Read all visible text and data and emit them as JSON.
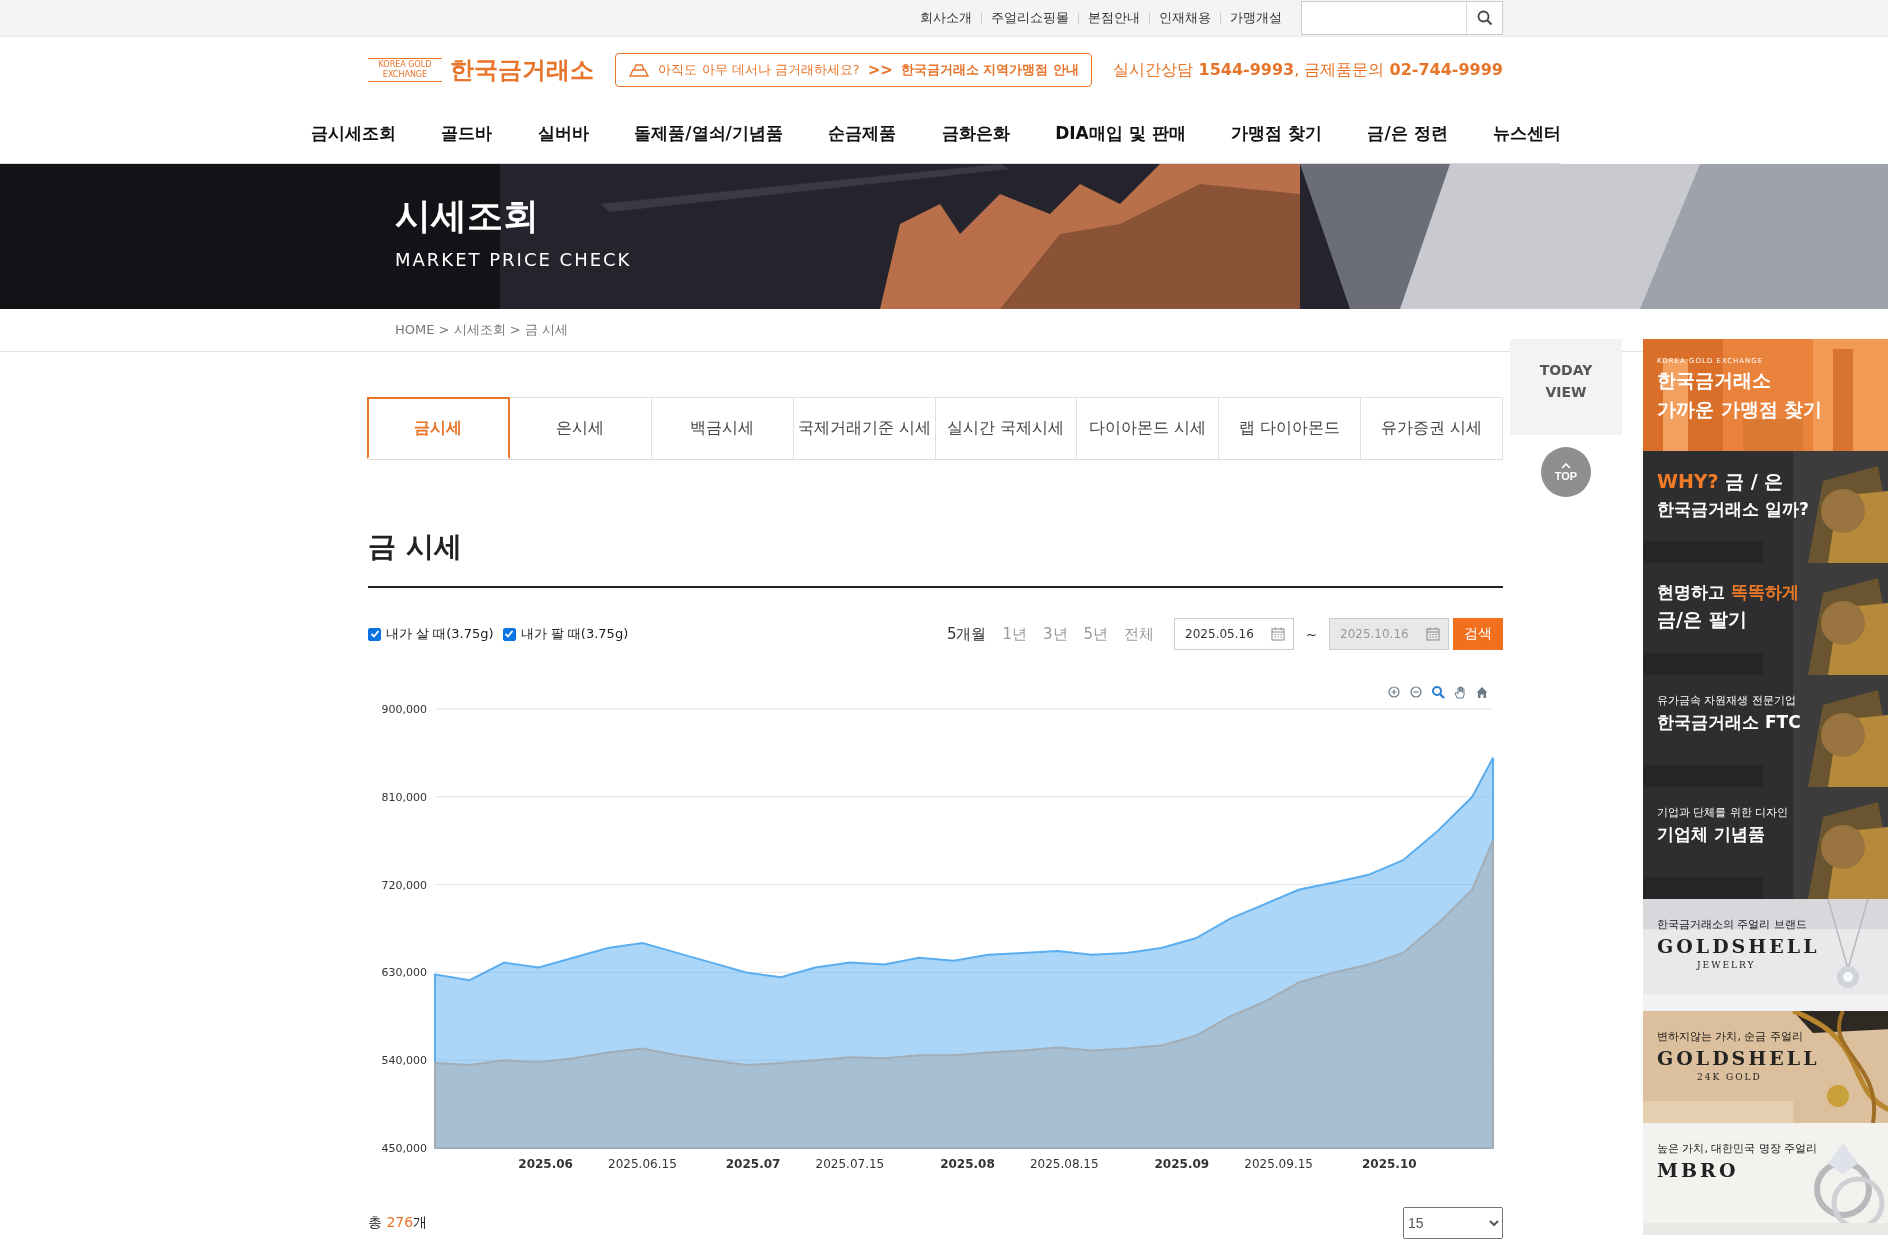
{
  "top_links": [
    {
      "label": "회사소개"
    },
    {
      "label": "주얼리쇼핑몰"
    },
    {
      "label": "본점안내"
    },
    {
      "label": "인재채용"
    },
    {
      "label": "가맹개설"
    }
  ],
  "header": {
    "logo_mark": "KOREA GOLD EXCHANGE",
    "logo_text": "한국금거래소",
    "notice_question": "아직도 아무 데서나 금거래하세요?",
    "notice_arrow": ">>",
    "notice_link": "한국금거래소 지역가맹점 안내",
    "contact": "실시간상담 **1544-9993**, 금제품문의 **02-744-9999**"
  },
  "nav": [
    "금시세조회",
    "골드바",
    "실버바",
    "돌제품/열쇠/기념품",
    "순금제품",
    "금화은화",
    "DIA매입 및 판매",
    "가맹점 찾기",
    "금/은 정련",
    "뉴스센터"
  ],
  "hero": {
    "title": "시세조회",
    "subtitle": "MARKET PRICE CHECK"
  },
  "breadcrumb": "HOME > 시세조회 > 금 시세",
  "tabs": [
    {
      "label": "금시세",
      "selected": true
    },
    {
      "label": "은시세",
      "selected": false
    },
    {
      "label": "백금시세",
      "selected": false
    },
    {
      "label": "국제거래기준 시세",
      "selected": false
    },
    {
      "label": "실시간 국제시세",
      "selected": false
    },
    {
      "label": "다이아몬드 시세",
      "selected": false
    },
    {
      "label": "랩 다이아몬드",
      "selected": false
    },
    {
      "label": "유가증권 시세",
      "selected": false
    }
  ],
  "section_title": "금 시세",
  "filters": [
    {
      "checked": true
    },
    {
      "checked": true
    }
  ],
  "periods": [
    {
      "label": "5개월",
      "selected": true
    },
    {
      "label": "1년",
      "selected": false
    },
    {
      "label": "3년",
      "selected": false
    },
    {
      "label": "5년",
      "selected": false
    },
    {
      "label": "전체",
      "selected": false
    }
  ],
  "date_from": {
    "value": "2025.05.16",
    "disabled": false
  },
  "date_sep": "~",
  "date_to": {
    "value": "2025.10.16",
    "disabled": true
  },
  "search_button": "검색",
  "chart_data": {
    "type": "area",
    "x": [
      "2025-05-16",
      "2025-05-21",
      "2025-05-26",
      "2025-05-31",
      "2025-06-05",
      "2025-06-10",
      "2025-06-15",
      "2025-06-20",
      "2025-06-25",
      "2025-06-30",
      "2025-07-05",
      "2025-07-10",
      "2025-07-15",
      "2025-07-20",
      "2025-07-25",
      "2025-07-30",
      "2025-08-04",
      "2025-08-09",
      "2025-08-14",
      "2025-08-19",
      "2025-08-24",
      "2025-08-29",
      "2025-09-03",
      "2025-09-08",
      "2025-09-13",
      "2025-09-18",
      "2025-09-23",
      "2025-09-28",
      "2025-10-03",
      "2025-10-08",
      "2025-10-13",
      "2025-10-16"
    ],
    "series": [
      {
        "name": "내가 살 때(3.75g)",
        "color": "#5aaef0",
        "values": [
          628000,
          622000,
          640000,
          635000,
          645000,
          655000,
          660000,
          650000,
          640000,
          630000,
          625000,
          635000,
          640000,
          638000,
          645000,
          642000,
          648000,
          650000,
          652000,
          648000,
          650000,
          655000,
          665000,
          685000,
          700000,
          715000,
          722000,
          730000,
          745000,
          775000,
          810000,
          850000
        ]
      },
      {
        "name": "내가 팔 때(3.75g)",
        "color": "#a3adb6",
        "values": [
          537000,
          535000,
          540000,
          538000,
          542000,
          548000,
          552000,
          545000,
          540000,
          535000,
          537000,
          540000,
          543000,
          542000,
          545000,
          545000,
          548000,
          550000,
          553000,
          550000,
          552000,
          555000,
          565000,
          585000,
          600000,
          620000,
          630000,
          638000,
          650000,
          680000,
          715000,
          765000
        ]
      }
    ],
    "xlim": [
      "2025-05-16",
      "2025-10-16"
    ],
    "ylim": [
      450000,
      900000
    ],
    "grid": true,
    "stacked": false,
    "xticks": [
      {
        "value": "2025-06-01",
        "label": "2025.06"
      },
      {
        "value": "2025-06-15",
        "label": "2025.06.15"
      },
      {
        "value": "2025-07-01",
        "label": "2025.07"
      },
      {
        "value": "2025-07-15",
        "label": "2025.07.15"
      },
      {
        "value": "2025-08-01",
        "label": "2025.08"
      },
      {
        "value": "2025-08-15",
        "label": "2025.08.15"
      },
      {
        "value": "2025-09-01",
        "label": "2025.09"
      },
      {
        "value": "2025-09-15",
        "label": "2025.09.15"
      },
      {
        "value": "2025-10-01",
        "label": "2025.10"
      }
    ],
    "yticks": [
      {
        "value": 450000,
        "label": "450,000"
      },
      {
        "value": 540000,
        "label": "540,000"
      },
      {
        "value": 630000,
        "label": "630,000"
      },
      {
        "value": 720000,
        "label": "720,000"
      },
      {
        "value": 810000,
        "label": "810,000"
      },
      {
        "value": 900000,
        "label": "900,000"
      }
    ]
  },
  "total": {
    "prefix": "총",
    "count": "276",
    "suffix": "개"
  },
  "page_size": "15",
  "quick_menu": {
    "today_view": "TODAY VIEW",
    "top_button": "TOP"
  },
  "banners": [
    {
      "kind": "orange",
      "lines": [
        {
          "kind": "mark",
          "parts": [
            {
              "text": "KOREA GOLD EXCHANGE",
              "accent": false
            }
          ]
        },
        {
          "kind": "large",
          "parts": [
            {
              "text": "한국금거래소",
              "accent": false
            }
          ]
        },
        {
          "kind": "large",
          "parts": [
            {
              "text": "가까운 가맹점 찾기",
              "accent": false
            }
          ]
        }
      ]
    },
    {
      "kind": "dark",
      "lines": [
        {
          "kind": "large",
          "parts": [
            {
              "text": "WHY?",
              "accent": true
            },
            {
              "text": " 금 / 은",
              "accent": false
            }
          ]
        },
        {
          "kind": "medium",
          "parts": [
            {
              "text": "한국금거래소 일까?",
              "accent": false
            }
          ]
        }
      ]
    },
    {
      "kind": "dark",
      "lines": [
        {
          "kind": "medium",
          "parts": [
            {
              "text": "현명하고 ",
              "accent": false
            },
            {
              "text": "똑똑하게",
              "accent": true
            }
          ]
        },
        {
          "kind": "large",
          "parts": [
            {
              "text": "금/은 팔기",
              "accent": false
            }
          ]
        }
      ]
    },
    {
      "kind": "dark",
      "lines": [
        {
          "kind": "small",
          "parts": [
            {
              "text": "유가금속 자원재생 전문기업",
              "accent": false
            }
          ]
        },
        {
          "kind": "medium",
          "parts": [
            {
              "text": "한국금거래소 FTC",
              "accent": false
            }
          ]
        }
      ]
    },
    {
      "kind": "dark",
      "lines": [
        {
          "kind": "small",
          "parts": [
            {
              "text": "기업과 단체를 위한 디자인",
              "accent": false
            }
          ]
        },
        {
          "kind": "medium",
          "parts": [
            {
              "text": "기업체 기념품",
              "accent": false
            }
          ]
        }
      ]
    },
    {
      "kind": "light",
      "lines": [
        {
          "kind": "small",
          "parts": [
            {
              "text": "한국금거래소의 주얼리 브랜드",
              "accent": false
            }
          ]
        },
        {
          "kind": "brand",
          "parts": [
            {
              "text": "GOLDSHELL",
              "accent": false
            }
          ]
        },
        {
          "kind": "caption",
          "parts": [
            {
              "text": "JEWELRY",
              "accent": false
            }
          ]
        }
      ]
    },
    {
      "kind": "beige",
      "lines": [
        {
          "kind": "small",
          "parts": [
            {
              "text": "변하지않는 가치, 순금 주얼리",
              "accent": false
            }
          ]
        },
        {
          "kind": "brand",
          "parts": [
            {
              "text": "GOLDSHELL",
              "accent": false
            }
          ]
        },
        {
          "kind": "caption",
          "parts": [
            {
              "text": "24K GOLD",
              "accent": false
            }
          ]
        }
      ]
    },
    {
      "kind": "white",
      "lines": [
        {
          "kind": "small",
          "parts": [
            {
              "text": "높은 가치, 대한민국 명장 주얼리",
              "accent": false
            }
          ]
        },
        {
          "kind": "brand",
          "parts": [
            {
              "text": "MBRO",
              "accent": false
            }
          ]
        }
      ]
    }
  ]
}
